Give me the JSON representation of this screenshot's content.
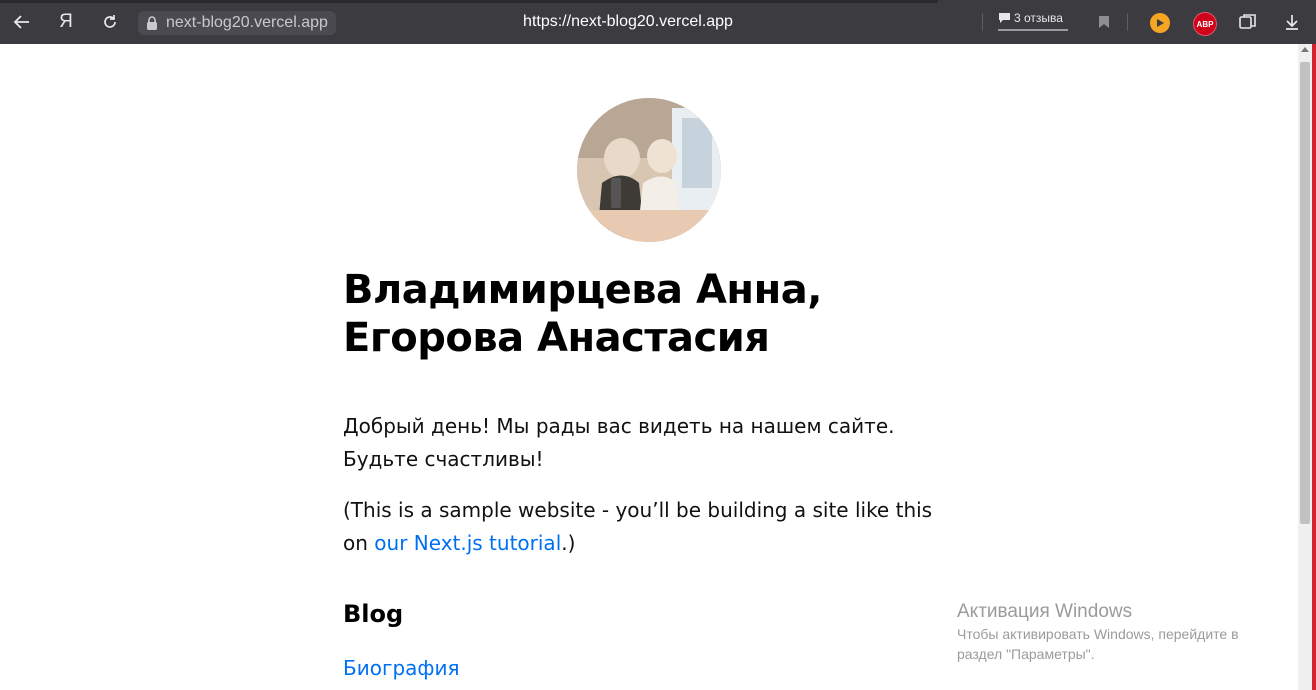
{
  "browser": {
    "address_short": "next-blog20.vercel.app",
    "address_full": "https://next-blog20.vercel.app",
    "reviews_label": "3 отзыва",
    "abp_label": "ABP",
    "yandex_label": "Я"
  },
  "page": {
    "name_line1": "Владимирцева Анна,",
    "name_line2": "Егорова Анастасия",
    "intro": "Добрый день! Мы рады вас видеть на нашем сайте. Будьте счастливы!",
    "sample_prefix": "(This is a sample website - you’ll be building a site like this on ",
    "tutorial_link": "our Next.js tutorial",
    "sample_suffix": ".)",
    "blog_heading": "Blog",
    "posts": [
      "Биография"
    ]
  },
  "watermark": {
    "title": "Активация Windows",
    "text": "Чтобы активировать Windows, перейдите в раздел \"Параметры\"."
  }
}
